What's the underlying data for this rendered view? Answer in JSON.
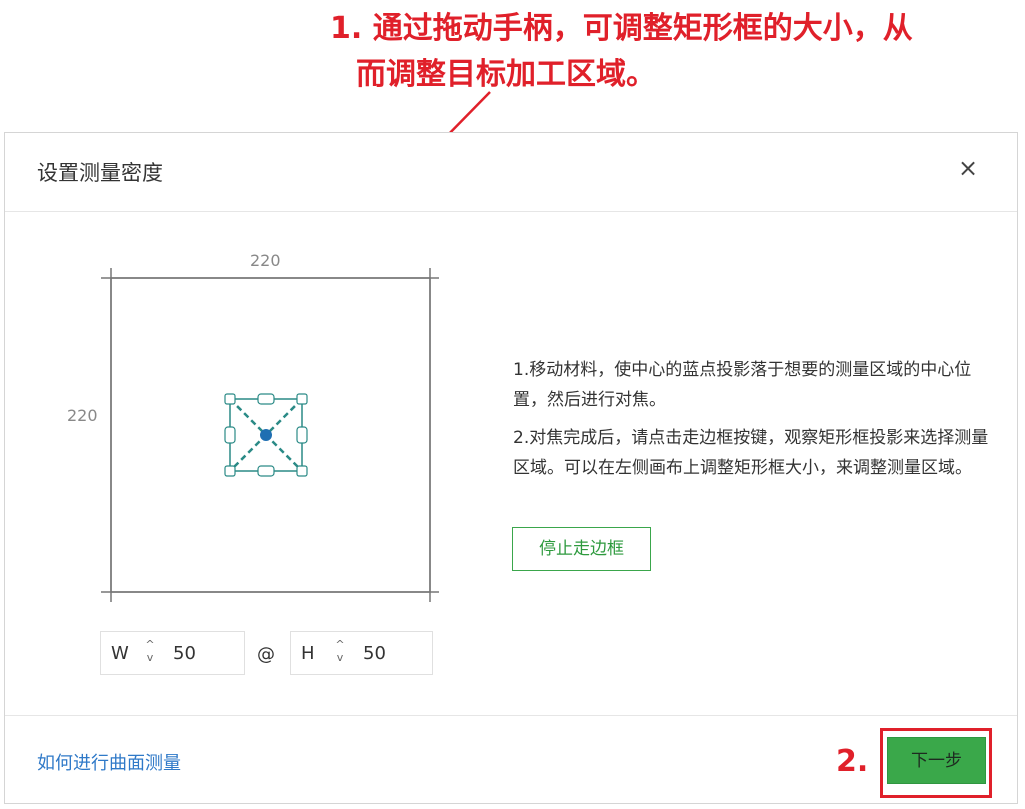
{
  "annotation": {
    "step1_line1": "1. 通过拖动手柄，可调整矩形框的大小，从",
    "step1_line2": "而调整目标加工区域。",
    "step2": "2."
  },
  "dialog": {
    "title": "设置测量密度",
    "close_symbol": "×"
  },
  "canvas": {
    "width_label": "220",
    "height_label": "220"
  },
  "fields": {
    "w_label": "W",
    "w_value": "50",
    "separator": "@",
    "h_label": "H",
    "h_value": "50",
    "stepper_up": "^",
    "stepper_down": "v"
  },
  "instructions": {
    "p1": "1.移动材料，使中心的蓝点投影落于想要的测量区域的中心位置，然后进行对焦。",
    "p2": "2.对焦完成后，请点击走边框按键，观察矩形框投影来选择测量区域。可以在左侧画布上调整矩形框大小，来调整测量区域。"
  },
  "buttons": {
    "stop_frame": "停止走边框",
    "next": "下一步"
  },
  "footer": {
    "help_link": "如何进行曲面测量"
  },
  "colors": {
    "accent_red": "#e0202a",
    "primary_green": "#3aa84a",
    "handle_teal": "#2a8a86",
    "center_dot": "#1f6fb2",
    "link_blue": "#2f79c8"
  }
}
